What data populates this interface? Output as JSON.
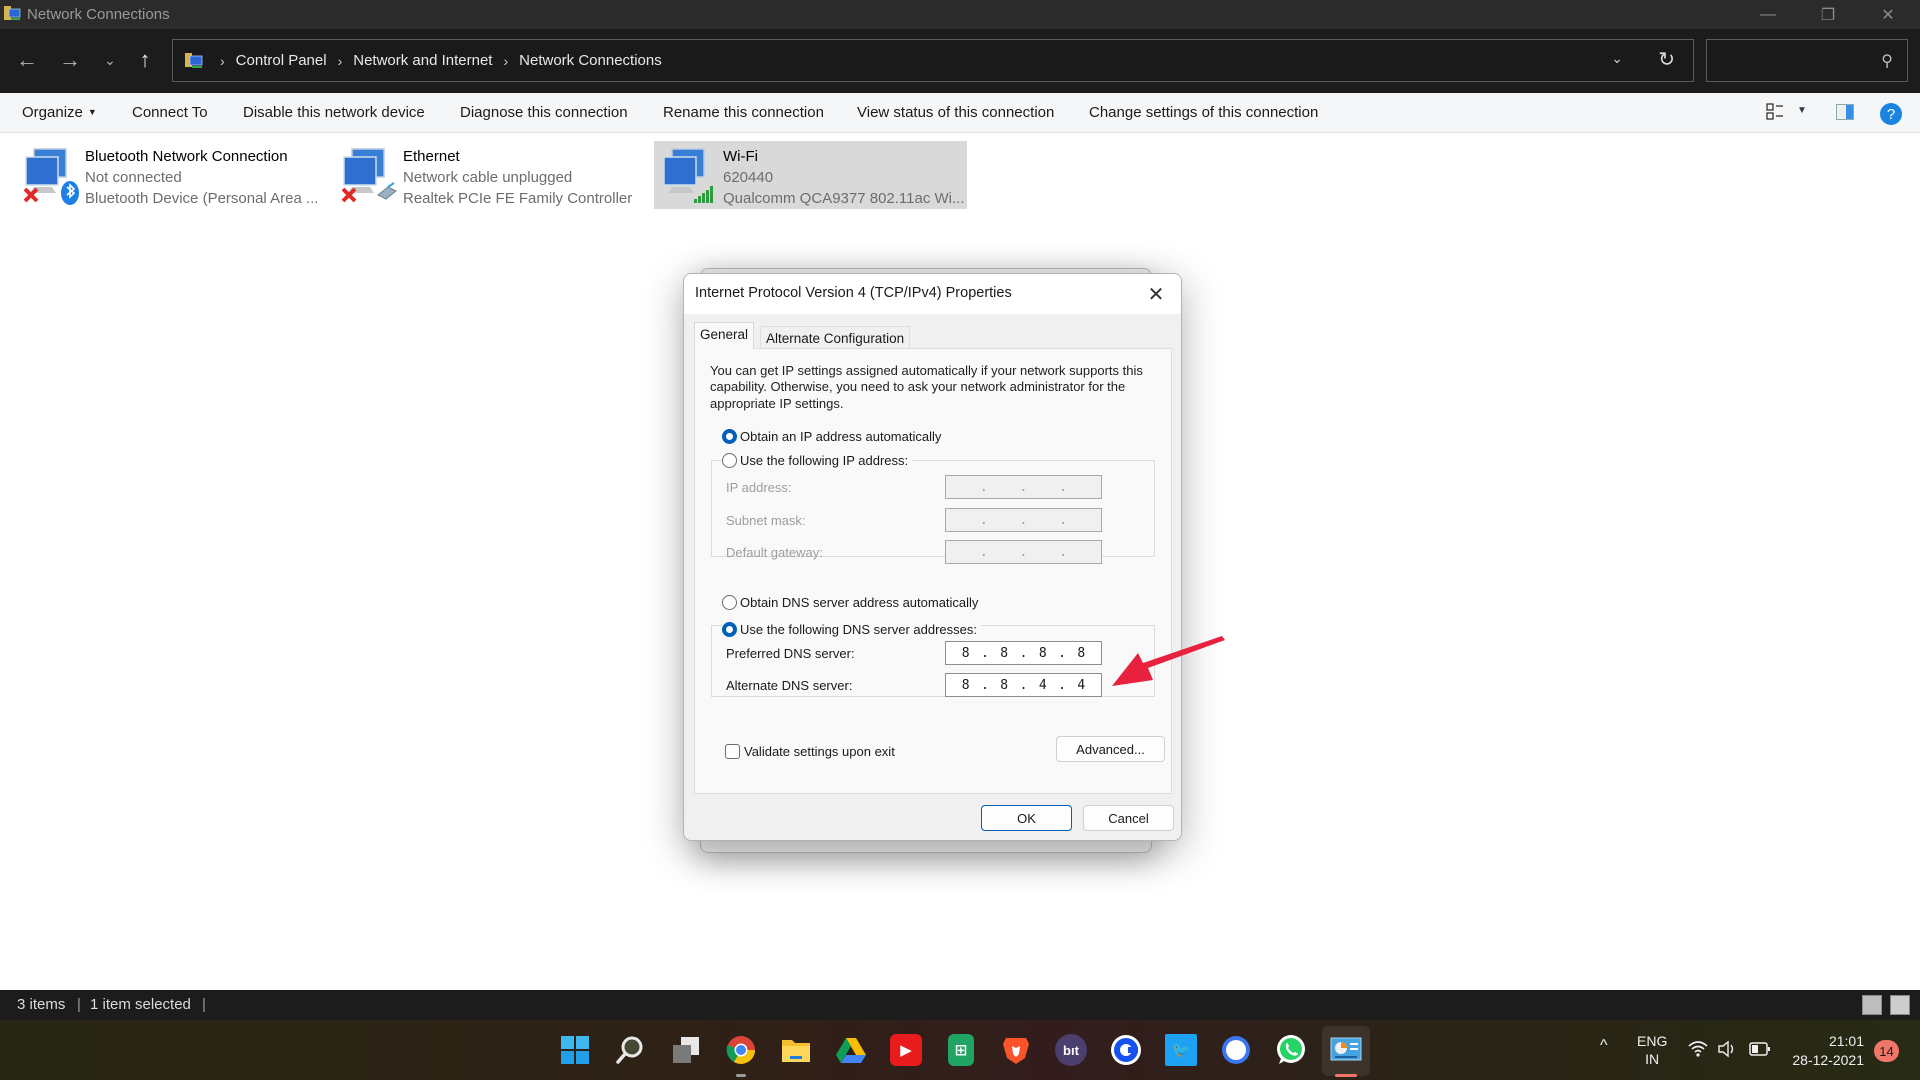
{
  "window": {
    "title": "Network Connections",
    "controls": {
      "minimize": "—",
      "maximize": "❐",
      "close": "✕"
    }
  },
  "nav": {
    "back_icon": "←",
    "forward_icon": "→",
    "recent_icon": "⌄",
    "up_icon": "↑",
    "breadcrumb": [
      "Control Panel",
      "Network and Internet",
      "Network Connections"
    ],
    "breadcrumb_separator": "›",
    "dropdown_icon": "⌄",
    "refresh_icon": "↻",
    "search_placeholder": "",
    "search_icon": "⚲"
  },
  "commandbar": {
    "items": [
      {
        "label": "Organize",
        "has_dropdown": true
      },
      {
        "label": "Connect To"
      },
      {
        "label": "Disable this network device"
      },
      {
        "label": "Diagnose this connection"
      },
      {
        "label": "Rename this connection"
      },
      {
        "label": "View status of this connection"
      },
      {
        "label": "Change settings of this connection"
      }
    ],
    "dropdown_caret": "▼",
    "view_caret": "▼",
    "help_label": "?"
  },
  "connections": [
    {
      "name": "Bluetooth Network Connection",
      "status": "Not connected",
      "device": "Bluetooth Device (Personal Area ...",
      "overlay": "disconnected",
      "badge": "bluetooth",
      "selected": false
    },
    {
      "name": "Ethernet",
      "status": "Network cable unplugged",
      "device": "Realtek PCIe FE Family Controller",
      "overlay": "disconnected",
      "badge": "ethernet-cable",
      "selected": false
    },
    {
      "name": "Wi-Fi",
      "status": "620440",
      "device": "Qualcomm QCA9377 802.11ac Wi...",
      "overlay": "none",
      "badge": "wifi-signal",
      "selected": true
    }
  ],
  "dialog": {
    "title": "Internet Protocol Version 4 (TCP/IPv4) Properties",
    "close_icon": "✕",
    "tabs": [
      {
        "label": "General",
        "active": true
      },
      {
        "label": "Alternate Configuration",
        "active": false
      }
    ],
    "intro": "You can get IP settings assigned automatically if your network supports this capability. Otherwise, you need to ask your network administrator for the appropriate IP settings.",
    "ip_mode": {
      "auto_label": "Obtain an IP address automatically",
      "manual_label": "Use the following IP address:",
      "selected": "auto"
    },
    "ip_fields": [
      {
        "label": "IP address:",
        "octets": [
          "",
          "",
          "",
          ""
        ],
        "enabled": false
      },
      {
        "label": "Subnet mask:",
        "octets": [
          "",
          "",
          "",
          ""
        ],
        "enabled": false
      },
      {
        "label": "Default gateway:",
        "octets": [
          "",
          "",
          "",
          ""
        ],
        "enabled": false
      }
    ],
    "dns_mode": {
      "auto_label": "Obtain DNS server address automatically",
      "manual_label": "Use the following DNS server addresses:",
      "selected": "manual"
    },
    "dns_fields": [
      {
        "label": "Preferred DNS server:",
        "octets": [
          "8",
          "8",
          "8",
          "8"
        ],
        "enabled": true
      },
      {
        "label": "Alternate DNS server:",
        "octets": [
          "8",
          "8",
          "4",
          "4"
        ],
        "enabled": true
      }
    ],
    "validate_label": "Validate settings upon exit",
    "validate_checked": false,
    "advanced_label": "Advanced...",
    "ok_label": "OK",
    "cancel_label": "Cancel"
  },
  "annotation": {
    "type": "arrow",
    "color": "#e8213f",
    "points_to": "Preferred DNS server"
  },
  "statusbar": {
    "item_count": "3 items",
    "selection": "1 item selected",
    "separator": "|"
  },
  "taskbar": {
    "apps": [
      {
        "name": "Start",
        "glyph": ""
      },
      {
        "name": "Search",
        "glyph": ""
      },
      {
        "name": "Task View",
        "glyph": ""
      },
      {
        "name": "Google Chrome",
        "glyph": ""
      },
      {
        "name": "File Explorer",
        "glyph": ""
      },
      {
        "name": "Google Drive",
        "glyph": ""
      },
      {
        "name": "YouTube",
        "glyph": "▶"
      },
      {
        "name": "Google Sheets",
        "glyph": "⊞"
      },
      {
        "name": "Brave",
        "glyph": "🦁"
      },
      {
        "name": "Bit",
        "glyph": "bıt"
      },
      {
        "name": "Coinbase",
        "glyph": "C"
      },
      {
        "name": "Twitter",
        "glyph": "🐦"
      },
      {
        "name": "Signal",
        "glyph": "💬"
      },
      {
        "name": "WhatsApp",
        "glyph": "✆"
      },
      {
        "name": "Control Panel",
        "glyph": ""
      }
    ],
    "tray": {
      "overflow_icon": "^",
      "lang_line1": "ENG",
      "lang_line2": "IN",
      "wifi_icon": "wifi",
      "volume_icon": "volume",
      "battery_icon": "battery",
      "time": "21:01",
      "date": "28-12-2021",
      "notification_count": "14"
    },
    "colors": {
      "chrome_indicator": "#9a9a9a",
      "active_indicator": "#f0766a"
    }
  }
}
